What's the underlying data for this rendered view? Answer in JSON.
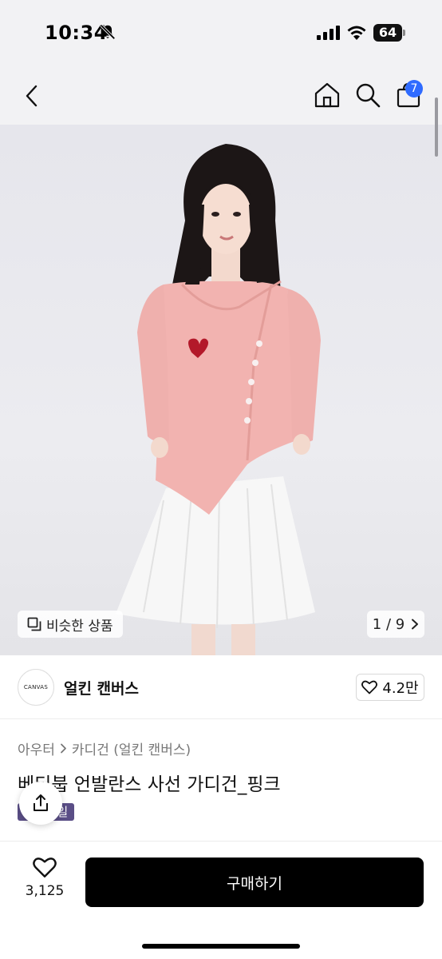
{
  "status_bar": {
    "time": "10:34",
    "battery": "64",
    "icons": [
      "bell-slash-icon",
      "signal-icon",
      "wifi-icon",
      "battery-icon"
    ]
  },
  "nav": {
    "icons": [
      "back-chevron-icon",
      "home-icon",
      "search-icon",
      "shopping-bag-icon"
    ],
    "cart_count": "7"
  },
  "gallery": {
    "similar_label": "비슷한 상품",
    "page_indicator": "1 / 9"
  },
  "brand": {
    "logo_text": "CANVAS",
    "name": "얼킨 캔버스",
    "likes": "4.2만"
  },
  "product": {
    "breadcrumb": [
      "아우터",
      "카디건 (얼킨 캔버스)"
    ],
    "title": "베티붑 언발란스 사선 가디건_핑크",
    "badge": "시즌세일"
  },
  "bottom_bar": {
    "wish_count": "3,125",
    "buy_label": "구매하기"
  },
  "colors": {
    "accent_blue": "#2f6bff",
    "badge_purple": "#5a4e86",
    "buy_button": "#000000"
  }
}
